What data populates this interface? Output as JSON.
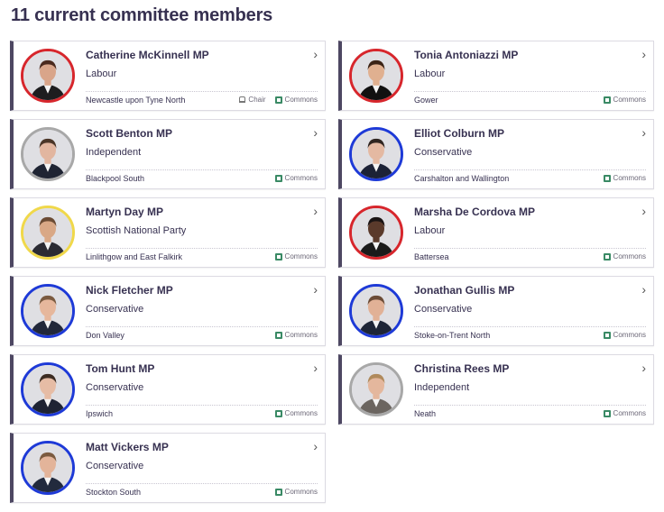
{
  "heading": "11 current committee members",
  "colors": {
    "labour": "#e4003b",
    "conservative": "#0a3bd1",
    "independent": "#aaaaaa",
    "snp": "#f2e25a",
    "accent": "#4d4762"
  },
  "members": [
    {
      "name": "Catherine McKinnell MP",
      "party": "Labour",
      "constituency": "Newcastle upon Tyne North",
      "chair": "Chair",
      "house": "Commons",
      "ring": "#d7262c",
      "skin": "#d9a58a",
      "hair": "#4b2a1e",
      "suit": "#1d1d1f"
    },
    {
      "name": "Tonia Antoniazzi MP",
      "party": "Labour",
      "constituency": "Gower",
      "house": "Commons",
      "ring": "#d7262c",
      "skin": "#e0b090",
      "hair": "#3b2316",
      "suit": "#111111"
    },
    {
      "name": "Scott Benton MP",
      "party": "Independent",
      "constituency": "Blackpool South",
      "house": "Commons",
      "ring": "#a8a8a8",
      "skin": "#e2b6a0",
      "hair": "#4a3527",
      "suit": "#1f2433"
    },
    {
      "name": "Elliot Colburn MP",
      "party": "Conservative",
      "constituency": "Carshalton and Wallington",
      "house": "Commons",
      "ring": "#1e3ad7",
      "skin": "#e4b9a2",
      "hair": "#2f2520",
      "suit": "#1c2236"
    },
    {
      "name": "Martyn Day MP",
      "party": "Scottish National Party",
      "constituency": "Linlithgow and East Falkirk",
      "house": "Commons",
      "ring": "#f0d84a",
      "skin": "#d9a886",
      "hair": "#6b4b34",
      "suit": "#2b2b33"
    },
    {
      "name": "Marsha De Cordova MP",
      "party": "Labour",
      "constituency": "Battersea",
      "house": "Commons",
      "ring": "#d7262c",
      "skin": "#5a3a2b",
      "hair": "#1a1414",
      "suit": "#1b1b1b"
    },
    {
      "name": "Nick Fletcher MP",
      "party": "Conservative",
      "constituency": "Don Valley",
      "house": "Commons",
      "ring": "#1e3ad7",
      "skin": "#e6b79c",
      "hair": "#7a5a40",
      "suit": "#22283a"
    },
    {
      "name": "Jonathan Gullis MP",
      "party": "Conservative",
      "constituency": "Stoke-on-Trent North",
      "house": "Commons",
      "ring": "#1e3ad7",
      "skin": "#e1b196",
      "hair": "#6b4b36",
      "suit": "#1e2536"
    },
    {
      "name": "Tom Hunt MP",
      "party": "Conservative",
      "constituency": "Ipswich",
      "house": "Commons",
      "ring": "#1e3ad7",
      "skin": "#e6bca5",
      "hair": "#3d2c22",
      "suit": "#1e2333"
    },
    {
      "name": "Christina Rees MP",
      "party": "Independent",
      "constituency": "Neath",
      "house": "Commons",
      "ring": "#a8a8a8",
      "skin": "#e4b79d",
      "hair": "#b08a5c",
      "suit": "#6b6560"
    },
    {
      "name": "Matt Vickers MP",
      "party": "Conservative",
      "constituency": "Stockton South",
      "house": "Commons",
      "ring": "#1e3ad7",
      "skin": "#e3b49a",
      "hair": "#7b5a3f",
      "suit": "#222a3d"
    }
  ]
}
